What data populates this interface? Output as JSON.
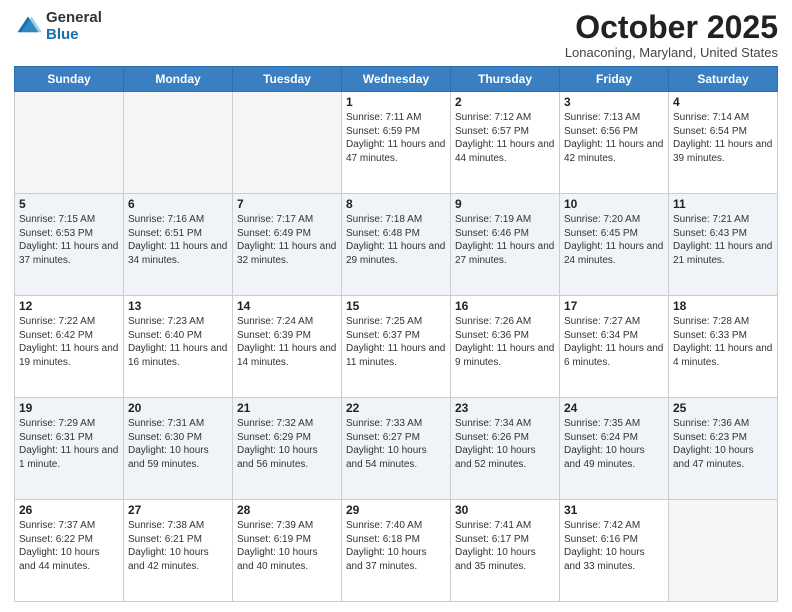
{
  "header": {
    "logo_general": "General",
    "logo_blue": "Blue",
    "month_title": "October 2025",
    "subtitle": "Lonaconing, Maryland, United States"
  },
  "days_of_week": [
    "Sunday",
    "Monday",
    "Tuesday",
    "Wednesday",
    "Thursday",
    "Friday",
    "Saturday"
  ],
  "weeks": [
    [
      {
        "day": "",
        "info": ""
      },
      {
        "day": "",
        "info": ""
      },
      {
        "day": "",
        "info": ""
      },
      {
        "day": "1",
        "info": "Sunrise: 7:11 AM\nSunset: 6:59 PM\nDaylight: 11 hours and 47 minutes."
      },
      {
        "day": "2",
        "info": "Sunrise: 7:12 AM\nSunset: 6:57 PM\nDaylight: 11 hours and 44 minutes."
      },
      {
        "day": "3",
        "info": "Sunrise: 7:13 AM\nSunset: 6:56 PM\nDaylight: 11 hours and 42 minutes."
      },
      {
        "day": "4",
        "info": "Sunrise: 7:14 AM\nSunset: 6:54 PM\nDaylight: 11 hours and 39 minutes."
      }
    ],
    [
      {
        "day": "5",
        "info": "Sunrise: 7:15 AM\nSunset: 6:53 PM\nDaylight: 11 hours and 37 minutes."
      },
      {
        "day": "6",
        "info": "Sunrise: 7:16 AM\nSunset: 6:51 PM\nDaylight: 11 hours and 34 minutes."
      },
      {
        "day": "7",
        "info": "Sunrise: 7:17 AM\nSunset: 6:49 PM\nDaylight: 11 hours and 32 minutes."
      },
      {
        "day": "8",
        "info": "Sunrise: 7:18 AM\nSunset: 6:48 PM\nDaylight: 11 hours and 29 minutes."
      },
      {
        "day": "9",
        "info": "Sunrise: 7:19 AM\nSunset: 6:46 PM\nDaylight: 11 hours and 27 minutes."
      },
      {
        "day": "10",
        "info": "Sunrise: 7:20 AM\nSunset: 6:45 PM\nDaylight: 11 hours and 24 minutes."
      },
      {
        "day": "11",
        "info": "Sunrise: 7:21 AM\nSunset: 6:43 PM\nDaylight: 11 hours and 21 minutes."
      }
    ],
    [
      {
        "day": "12",
        "info": "Sunrise: 7:22 AM\nSunset: 6:42 PM\nDaylight: 11 hours and 19 minutes."
      },
      {
        "day": "13",
        "info": "Sunrise: 7:23 AM\nSunset: 6:40 PM\nDaylight: 11 hours and 16 minutes."
      },
      {
        "day": "14",
        "info": "Sunrise: 7:24 AM\nSunset: 6:39 PM\nDaylight: 11 hours and 14 minutes."
      },
      {
        "day": "15",
        "info": "Sunrise: 7:25 AM\nSunset: 6:37 PM\nDaylight: 11 hours and 11 minutes."
      },
      {
        "day": "16",
        "info": "Sunrise: 7:26 AM\nSunset: 6:36 PM\nDaylight: 11 hours and 9 minutes."
      },
      {
        "day": "17",
        "info": "Sunrise: 7:27 AM\nSunset: 6:34 PM\nDaylight: 11 hours and 6 minutes."
      },
      {
        "day": "18",
        "info": "Sunrise: 7:28 AM\nSunset: 6:33 PM\nDaylight: 11 hours and 4 minutes."
      }
    ],
    [
      {
        "day": "19",
        "info": "Sunrise: 7:29 AM\nSunset: 6:31 PM\nDaylight: 11 hours and 1 minute."
      },
      {
        "day": "20",
        "info": "Sunrise: 7:31 AM\nSunset: 6:30 PM\nDaylight: 10 hours and 59 minutes."
      },
      {
        "day": "21",
        "info": "Sunrise: 7:32 AM\nSunset: 6:29 PM\nDaylight: 10 hours and 56 minutes."
      },
      {
        "day": "22",
        "info": "Sunrise: 7:33 AM\nSunset: 6:27 PM\nDaylight: 10 hours and 54 minutes."
      },
      {
        "day": "23",
        "info": "Sunrise: 7:34 AM\nSunset: 6:26 PM\nDaylight: 10 hours and 52 minutes."
      },
      {
        "day": "24",
        "info": "Sunrise: 7:35 AM\nSunset: 6:24 PM\nDaylight: 10 hours and 49 minutes."
      },
      {
        "day": "25",
        "info": "Sunrise: 7:36 AM\nSunset: 6:23 PM\nDaylight: 10 hours and 47 minutes."
      }
    ],
    [
      {
        "day": "26",
        "info": "Sunrise: 7:37 AM\nSunset: 6:22 PM\nDaylight: 10 hours and 44 minutes."
      },
      {
        "day": "27",
        "info": "Sunrise: 7:38 AM\nSunset: 6:21 PM\nDaylight: 10 hours and 42 minutes."
      },
      {
        "day": "28",
        "info": "Sunrise: 7:39 AM\nSunset: 6:19 PM\nDaylight: 10 hours and 40 minutes."
      },
      {
        "day": "29",
        "info": "Sunrise: 7:40 AM\nSunset: 6:18 PM\nDaylight: 10 hours and 37 minutes."
      },
      {
        "day": "30",
        "info": "Sunrise: 7:41 AM\nSunset: 6:17 PM\nDaylight: 10 hours and 35 minutes."
      },
      {
        "day": "31",
        "info": "Sunrise: 7:42 AM\nSunset: 6:16 PM\nDaylight: 10 hours and 33 minutes."
      },
      {
        "day": "",
        "info": ""
      }
    ]
  ]
}
